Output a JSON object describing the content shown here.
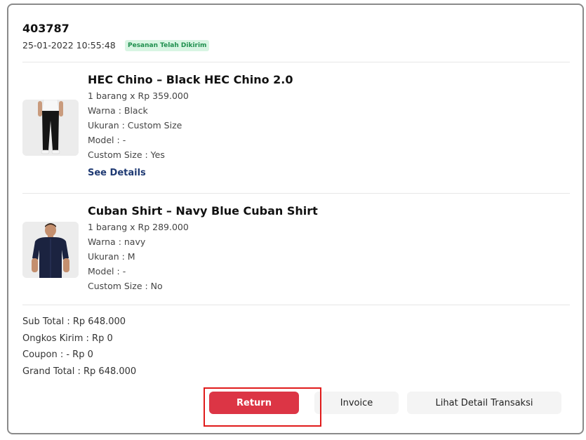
{
  "order": {
    "id": "403787",
    "date": "25-01-2022 10:55:48",
    "status": "Pesanan Telah Dikirim"
  },
  "products": [
    {
      "title": "HEC Chino – Black HEC Chino 2.0",
      "qty_price": "1 barang x Rp 359.000",
      "color": "Warna : Black",
      "size": "Ukuran : Custom Size",
      "model": "Model : -",
      "custom_size": "Custom Size : Yes",
      "see_details": "See Details"
    },
    {
      "title": "Cuban Shirt – Navy Blue Cuban Shirt",
      "qty_price": "1 barang x Rp 289.000",
      "color": "Warna : navy",
      "size": "Ukuran : M",
      "model": "Model : -",
      "custom_size": "Custom Size : No"
    }
  ],
  "totals": {
    "sub_total": "Sub Total : Rp 648.000",
    "shipping": "Ongkos Kirim : Rp 0",
    "coupon": "Coupon : - Rp 0",
    "grand_total": "Grand Total : Rp 648.000"
  },
  "actions": {
    "return_label": "Return",
    "invoice_label": "Invoice",
    "detail_label": "Lihat Detail Transaksi"
  },
  "colors": {
    "status_text": "#1f8f4e",
    "status_bg": "#d8f5e3",
    "link": "#1f3a73",
    "primary": "#dc3545",
    "highlight": "#e01b1b"
  }
}
